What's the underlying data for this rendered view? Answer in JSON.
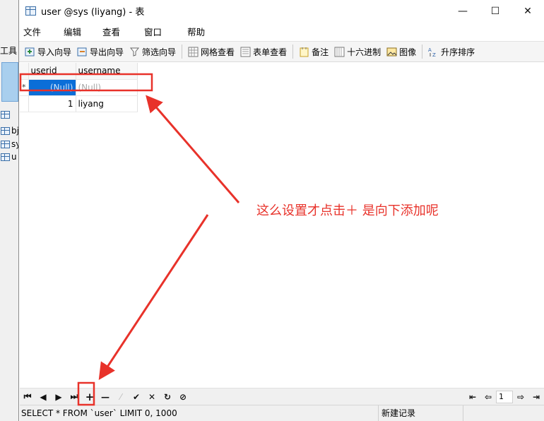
{
  "background_app": {
    "toolbar_label": "工具",
    "items": [
      {
        "label": "bj"
      },
      {
        "label": "sy"
      },
      {
        "label": "u"
      }
    ]
  },
  "window": {
    "title": "user @sys (liyang) - 表",
    "controls": {
      "minimize": "—",
      "maximize": "☐",
      "close": "✕"
    }
  },
  "menu": [
    "文件",
    "编辑",
    "查看",
    "窗口",
    "帮助"
  ],
  "toolbar": {
    "import_wizard": "导入向导",
    "export_wizard": "导出向导",
    "filter_wizard": "筛选向导",
    "grid_view": "网格查看",
    "form_view": "表单查看",
    "memo": "备注",
    "hex": "十六进制",
    "image": "图像",
    "sort": "升序排序"
  },
  "grid": {
    "columns": [
      "userid",
      "username"
    ],
    "new_row_marker": "*",
    "rows": [
      {
        "userid": "(Null)",
        "username": "(Null)"
      },
      {
        "userid": "1",
        "username": "liyang"
      }
    ]
  },
  "annotation": {
    "text": "这么设置才点击＋ 是向下添加呢",
    "color": "#e8322a"
  },
  "navbar": {
    "first": "⏮",
    "prev": "◀",
    "next": "▶",
    "last": "⏭",
    "add": "+",
    "delete": "—",
    "edit": "⁄",
    "apply": "✔",
    "cancel": "✕",
    "refresh": "↻",
    "stop": "⊘",
    "page_first": "⇤",
    "page_prev": "⇦",
    "page_number": "1",
    "page_next": "⇨",
    "page_last": "⇥"
  },
  "status": {
    "sql": "SELECT * FROM `user` LIMIT 0, 1000",
    "mode": "新建记录"
  },
  "colors": {
    "accent": "#0b6ed8",
    "annotation": "#e8322a"
  }
}
